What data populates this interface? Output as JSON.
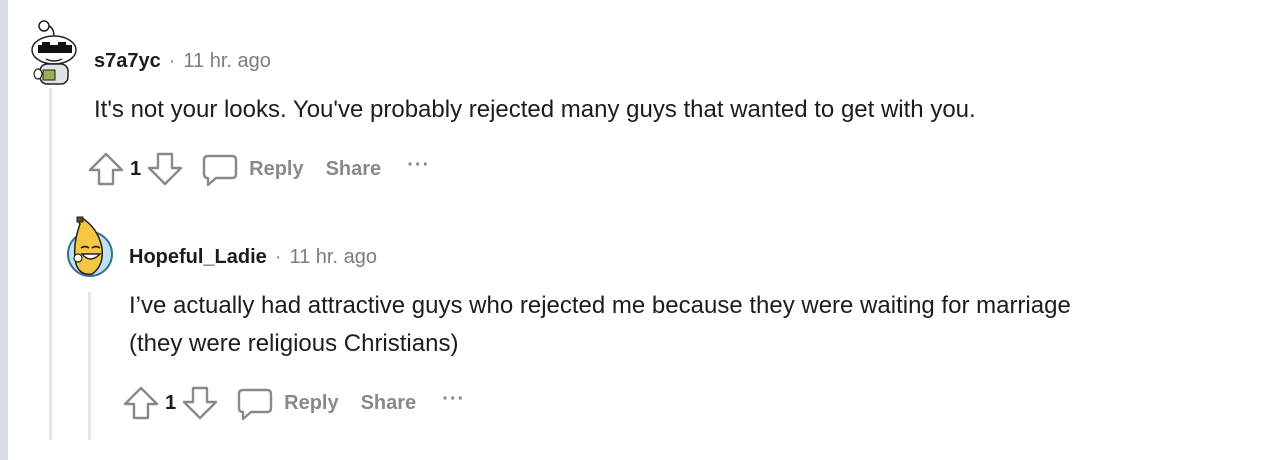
{
  "comments": [
    {
      "author": "s7a7yc",
      "separator": "·",
      "time": "11 hr. ago",
      "avatar": "snoo-sunglasses-avatar",
      "text": "It's not your looks. You've probably rejected many guys that wanted to get with you.",
      "votes": "1",
      "reply_label": "Reply",
      "share_label": "Share",
      "more_label": "···"
    },
    {
      "author": "Hopeful_Ladie",
      "separator": "·",
      "time": "11 hr. ago",
      "avatar": "banana-avatar",
      "text_lines": [
        "I’ve actually had attractive guys who rejected me because they were waiting for marriage",
        "(they were religious Christians)"
      ],
      "votes": "1",
      "reply_label": "Reply",
      "share_label": "Share",
      "more_label": "···"
    }
  ],
  "colors": {
    "text": "#1c1c1c",
    "meta": "#7c7c7c",
    "action": "#878a8c",
    "thread_line": "#e5e7eb",
    "left_bar": "#dadde3"
  },
  "icons": [
    "upvote-icon",
    "downvote-icon",
    "comment-bubble-icon"
  ]
}
